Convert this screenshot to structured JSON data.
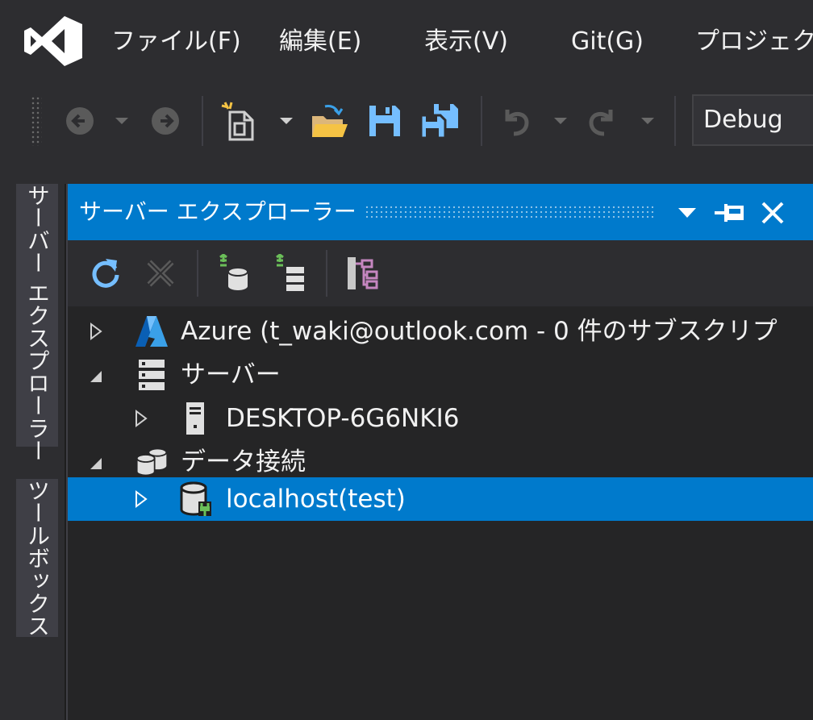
{
  "menu": {
    "file": "ファイル(F)",
    "edit": "編集(E)",
    "view": "表示(V)",
    "git": "Git(G)",
    "project": "プロジェクト"
  },
  "toolbar": {
    "configuration": "Debug"
  },
  "side_tabs": {
    "server_explorer": "サーバー エクスプローラー",
    "toolbox": "ツールボックス"
  },
  "panel": {
    "title": "サーバー エクスプローラー"
  },
  "tree": {
    "azure": "Azure (t_waki@outlook.com - 0 件のサブスクリプ",
    "servers": "サーバー",
    "desktop": "DESKTOP-6G6NKI6",
    "data_connections": "データ接続",
    "localhost": "localhost(test)"
  },
  "colors": {
    "accent": "#007acc",
    "background": "#1e1e1e",
    "chrome": "#2d2d30",
    "panel": "#252526",
    "vs_purple": "#ffffff"
  }
}
